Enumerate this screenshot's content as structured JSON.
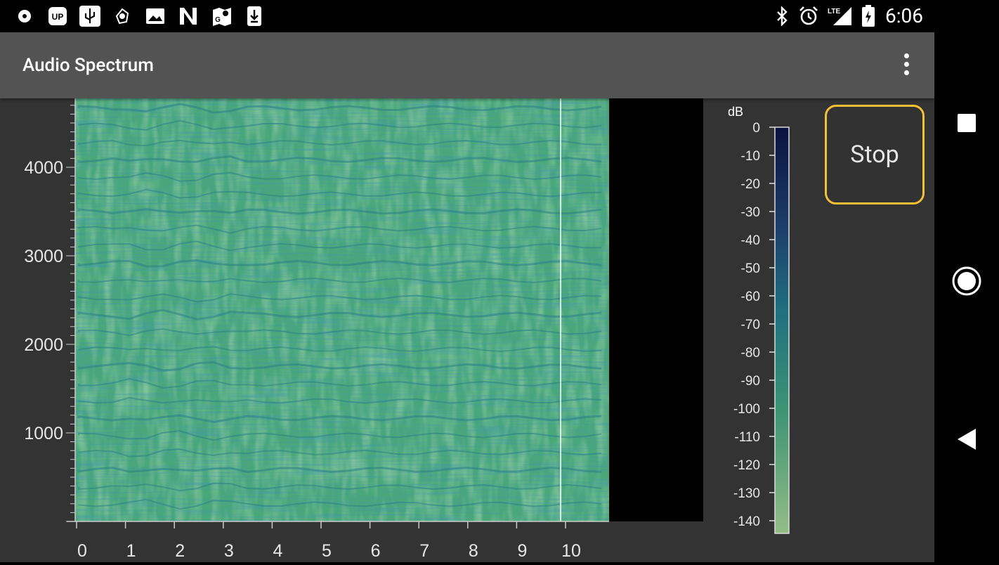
{
  "status_bar": {
    "time": "6:06",
    "network": "LTE",
    "left_icons": [
      "record-icon",
      "uplay-icon",
      "usb-icon",
      "assistant-icon",
      "image-icon",
      "n-app-icon",
      "maps-icon",
      "download-icon"
    ],
    "right_icons": [
      "bluetooth-icon",
      "alarm-icon",
      "signal-lte-icon",
      "battery-charging-icon"
    ]
  },
  "app_bar": {
    "title": "Audio Spectrum",
    "menu_icon": "more-vert-icon"
  },
  "controls": {
    "stop_label": "Stop"
  },
  "spectrogram": {
    "y_ticks": [
      "1000",
      "2000",
      "3000",
      "4000"
    ],
    "x_ticks": [
      "0",
      "1",
      "2",
      "3",
      "4",
      "5",
      "6",
      "7",
      "8",
      "9",
      "10"
    ],
    "cursor_time": 9.9,
    "colors": {
      "low": "#8fbf86",
      "mid": "#3e9f7d",
      "high": "#1f6f8f",
      "max": "#0b1a4a"
    }
  },
  "colorbar": {
    "unit": "dB",
    "ticks": [
      "0",
      "-10",
      "-20",
      "-30",
      "-40",
      "-50",
      "-60",
      "-70",
      "-80",
      "-90",
      "-100",
      "-110",
      "-120",
      "-130",
      "-140"
    ]
  },
  "nav_bar": {
    "buttons": [
      "recents-icon",
      "home-icon",
      "back-icon"
    ]
  }
}
